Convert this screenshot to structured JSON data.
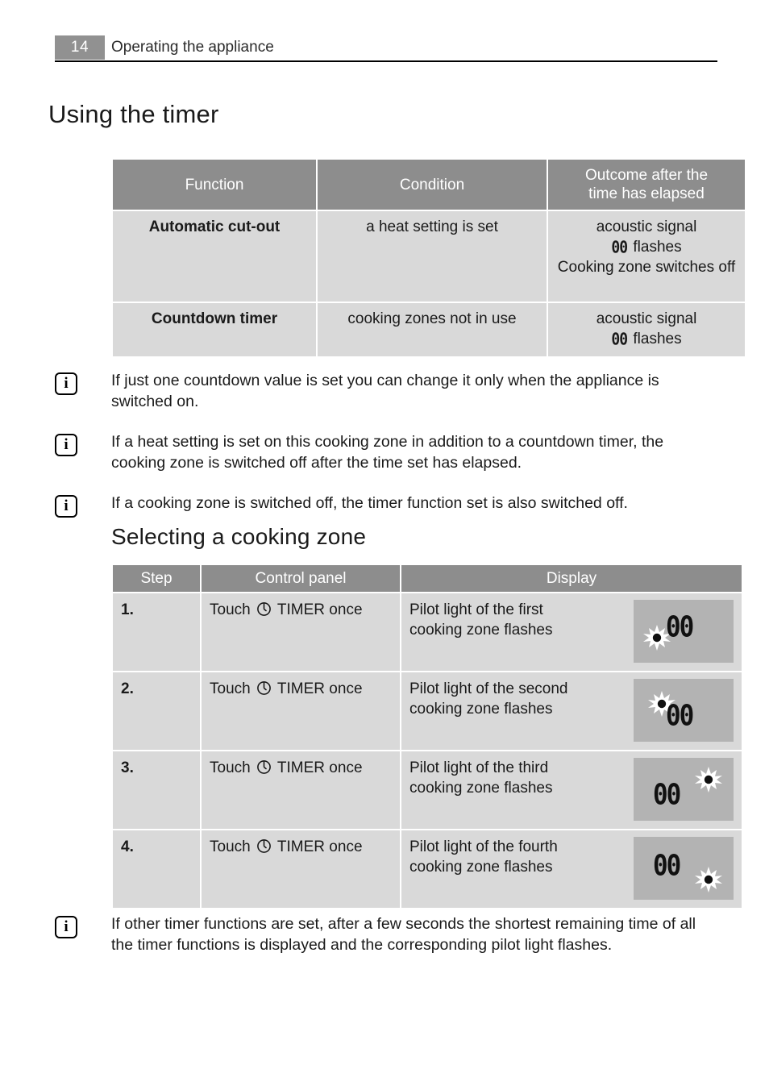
{
  "header": {
    "page_number": "14",
    "title": "Operating the appliance"
  },
  "sections": {
    "using_timer_title": "Using the timer",
    "selecting_zone_title": "Selecting a cooking zone"
  },
  "timer_functions_table": {
    "columns": [
      "Function",
      "Condition",
      "Outcome after the time has elapsed"
    ],
    "column_headers": {
      "function": "Function",
      "condition": "Condition",
      "outcome_line1": "Outcome after the",
      "outcome_line2": "time has elapsed"
    },
    "rows": [
      {
        "function": "Automatic cut-out",
        "condition": "a heat setting is set",
        "outcome_line1": "acoustic signal",
        "outcome_digits": "00",
        "outcome_flashes": " flashes",
        "outcome_line3": "Cooking zone switches off"
      },
      {
        "function": "Countdown timer",
        "condition": "cooking zones not in use",
        "outcome_line1": "acoustic signal",
        "outcome_digits": "00",
        "outcome_flashes": " flashes",
        "outcome_line3": ""
      }
    ]
  },
  "notes": [
    {
      "icon": "info-icon",
      "glyph": "i",
      "text": "If just one countdown value is set you can change it only when the appliance is switched on."
    },
    {
      "icon": "info-icon",
      "glyph": "i",
      "text": "If a heat setting is set on this cooking zone in addition to a countdown timer, the cooking zone is switched off after the time set has elapsed."
    },
    {
      "icon": "info-icon",
      "glyph": "i",
      "text": "If a cooking zone is switched off, the timer function set is also switched off."
    },
    {
      "icon": "info-icon",
      "glyph": "i",
      "text": "If other timer functions are set, after a few seconds the shortest remaining time of all the timer functions is displayed and the corresponding pilot light flashes."
    }
  ],
  "select_zone_table": {
    "column_headers": {
      "step": "Step",
      "control_panel": "Control panel",
      "display": "Display"
    },
    "rows": [
      {
        "step": "1.",
        "control_before": "Touch",
        "control_icon": "timer-clock-icon",
        "control_after": "TIMER once",
        "display_line1": "Pilot light of the first",
        "display_line2": "cooking zone flashes",
        "lcd_digits": "00",
        "pilot_position": "bottom-left"
      },
      {
        "step": "2.",
        "control_before": "Touch",
        "control_icon": "timer-clock-icon",
        "control_after": "TIMER once",
        "display_line1": "Pilot light of the second",
        "display_line2": "cooking zone flashes",
        "lcd_digits": "00",
        "pilot_position": "top-left"
      },
      {
        "step": "3.",
        "control_before": "Touch",
        "control_icon": "timer-clock-icon",
        "control_after": "TIMER once",
        "display_line1": "Pilot light of the third",
        "display_line2": "cooking zone flashes",
        "lcd_digits": "00",
        "pilot_position": "top-right"
      },
      {
        "step": "4.",
        "control_before": "Touch",
        "control_icon": "timer-clock-icon",
        "control_after": "TIMER once",
        "display_line1": "Pilot light of the fourth",
        "display_line2": "cooking zone flashes",
        "lcd_digits": "00",
        "pilot_position": "bottom-right"
      }
    ]
  },
  "colors": {
    "table_header_bg": "#8d8d8d",
    "table_cell_bg": "#d9d9d9",
    "lcd_panel_bg": "#b3b3b3",
    "page_badge_bg": "#919191",
    "text": "#1a1a1a"
  }
}
